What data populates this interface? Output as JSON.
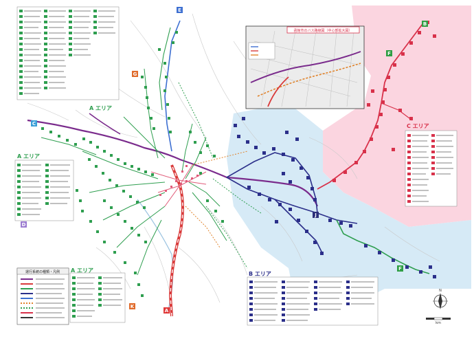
{
  "area_labels": {
    "a_north": "A エリア",
    "a_west": "A エリア",
    "a_south": "A エリア",
    "b": "B エリア",
    "c": "C エリア"
  },
  "route_badges": [
    {
      "letter": "A",
      "color": "#e03a3a"
    },
    {
      "letter": "B",
      "color": "#2f9e44"
    },
    {
      "letter": "C",
      "color": "#3b9fd8"
    },
    {
      "letter": "D",
      "color": "#9b7bd0"
    },
    {
      "letter": "E",
      "color": "#3d6fd1"
    },
    {
      "letter": "F",
      "color": "#2f9e44"
    },
    {
      "letter": "G",
      "color": "#e06a2a"
    },
    {
      "letter": "J",
      "color": "#2b2f7a"
    },
    {
      "letter": "K",
      "color": "#e06a2a"
    }
  ],
  "inset": {
    "title": "函館市のバス路線図（中心部拡大図）"
  },
  "legend": {
    "title": "運行系統の種類・凡例"
  },
  "compass": {
    "north": "N"
  },
  "scale": {
    "unit": "km"
  },
  "colors": {
    "area_a": "#2e9e4f",
    "area_b": "#2b2f8a",
    "area_c": "#d8314a",
    "zone_b": "#d6eaf6",
    "zone_c": "#fbd5e0",
    "main_route": "#7a2b8c",
    "rail": "#d93a3a"
  }
}
